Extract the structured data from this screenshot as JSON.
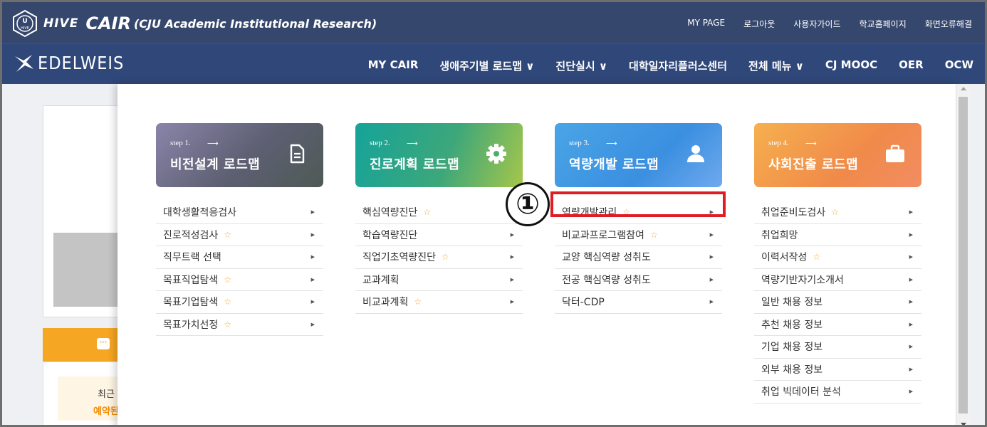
{
  "header": {
    "hive_label": "HIVE",
    "title": "CAIR",
    "subtitle": "(CJU Academic Institutional Research)",
    "links": [
      "MY PAGE",
      "로그아웃",
      "사용자가이드",
      "학교홈페이지",
      "화면오류해결"
    ]
  },
  "nav": {
    "logo_text": "EDELWEIS",
    "items": [
      "MY CAIR",
      "생애주기별 로드맵 ∨",
      "진단실시 ∨",
      "대학일자리플러스센터",
      "전체 메뉴 ∨",
      "CJ MOOC",
      "OER",
      "OCW"
    ]
  },
  "behind": {
    "recent_text": "최근",
    "reserve_text": "예약된"
  },
  "menu": {
    "columns": [
      {
        "step": "step 1.",
        "arrow": "⟶",
        "title": "비전설계 로드맵",
        "icon": "document-icon",
        "items": [
          {
            "label": "대학생활적응검사",
            "star": false
          },
          {
            "label": "진로적성검사",
            "star": true
          },
          {
            "label": "직무트랙 선택",
            "star": false
          },
          {
            "label": "목표직업탐색",
            "star": true
          },
          {
            "label": "목표기업탐색",
            "star": true
          },
          {
            "label": "목표가치선정",
            "star": true
          }
        ]
      },
      {
        "step": "step 2.",
        "arrow": "⟶",
        "title": "진로계획 로드맵",
        "icon": "gear-icon",
        "items": [
          {
            "label": "핵심역량진단",
            "star": true
          },
          {
            "label": "학습역량진단",
            "star": false
          },
          {
            "label": "직업기초역량진단",
            "star": true
          },
          {
            "label": "교과계획",
            "star": false
          },
          {
            "label": "비교과계획",
            "star": true
          }
        ]
      },
      {
        "step": "step 3.",
        "arrow": "⟶",
        "title": "역량개발 로드맵",
        "icon": "user-icon",
        "items": [
          {
            "label": "역량개발관리",
            "star": true
          },
          {
            "label": "비교과프로그램참여",
            "star": true
          },
          {
            "label": "교양 핵심역량 성취도",
            "star": false
          },
          {
            "label": "전공 핵심역량 성취도",
            "star": false
          },
          {
            "label": "닥터-CDP",
            "star": false
          }
        ]
      },
      {
        "step": "step 4.",
        "arrow": "⟶",
        "title": "사회진출 로드맵",
        "icon": "briefcase-icon",
        "items": [
          {
            "label": "취업준비도검사",
            "star": true
          },
          {
            "label": "취업희망",
            "star": false
          },
          {
            "label": "이력서작성",
            "star": true
          },
          {
            "label": "역량기반자기소개서",
            "star": false
          },
          {
            "label": "일반 채용 정보",
            "star": false
          },
          {
            "label": "추천 채용 정보",
            "star": false
          },
          {
            "label": "기업 채용 정보",
            "star": false
          },
          {
            "label": "외부 채용 정보",
            "star": false
          },
          {
            "label": "취업 빅데이터 분석",
            "star": false
          }
        ]
      }
    ],
    "star_glyph": "☆",
    "caret_glyph": "▶"
  },
  "annotation": {
    "marker": "①"
  }
}
